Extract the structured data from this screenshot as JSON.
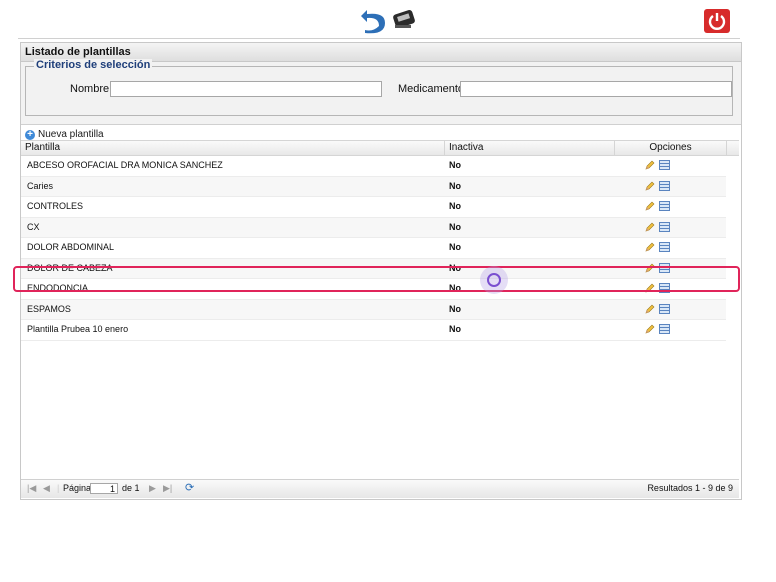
{
  "panel": {
    "title": "Listado de plantillas"
  },
  "criteria": {
    "legend": "Criterios de selección",
    "name_label": "Nombre:",
    "name_value": "",
    "med_label": "Medicamento:",
    "med_value": ""
  },
  "toolbar": {
    "new_label": "Nueva plantilla"
  },
  "columns": {
    "plantilla": "Plantilla",
    "inactiva": "Inactiva",
    "opciones": "Opciones"
  },
  "rows": [
    {
      "name": "ABCESO OROFACIAL DRA MONICA SANCHEZ",
      "inactiva": "No"
    },
    {
      "name": "Caries",
      "inactiva": "No"
    },
    {
      "name": "CONTROLES",
      "inactiva": "No"
    },
    {
      "name": "CX",
      "inactiva": "No"
    },
    {
      "name": "DOLOR ABDOMINAL",
      "inactiva": "No"
    },
    {
      "name": "DOLOR DE CABEZA",
      "inactiva": "No"
    },
    {
      "name": "ENDODONCIA",
      "inactiva": "No"
    },
    {
      "name": "ESPAMOS",
      "inactiva": "No"
    },
    {
      "name": "Plantilla Prubea 10 enero",
      "inactiva": "No"
    }
  ],
  "pager": {
    "page_label": "Página",
    "page_value": "1",
    "of_label": "de 1",
    "results": "Resultados 1 - 9 de 9"
  },
  "icons": {
    "back": "back-arrow-icon",
    "scanner": "scanner-icon",
    "power": "power-icon"
  },
  "colors": {
    "highlight": "#e0245a",
    "power": "#d72b2b",
    "legend": "#1f3f7a"
  }
}
